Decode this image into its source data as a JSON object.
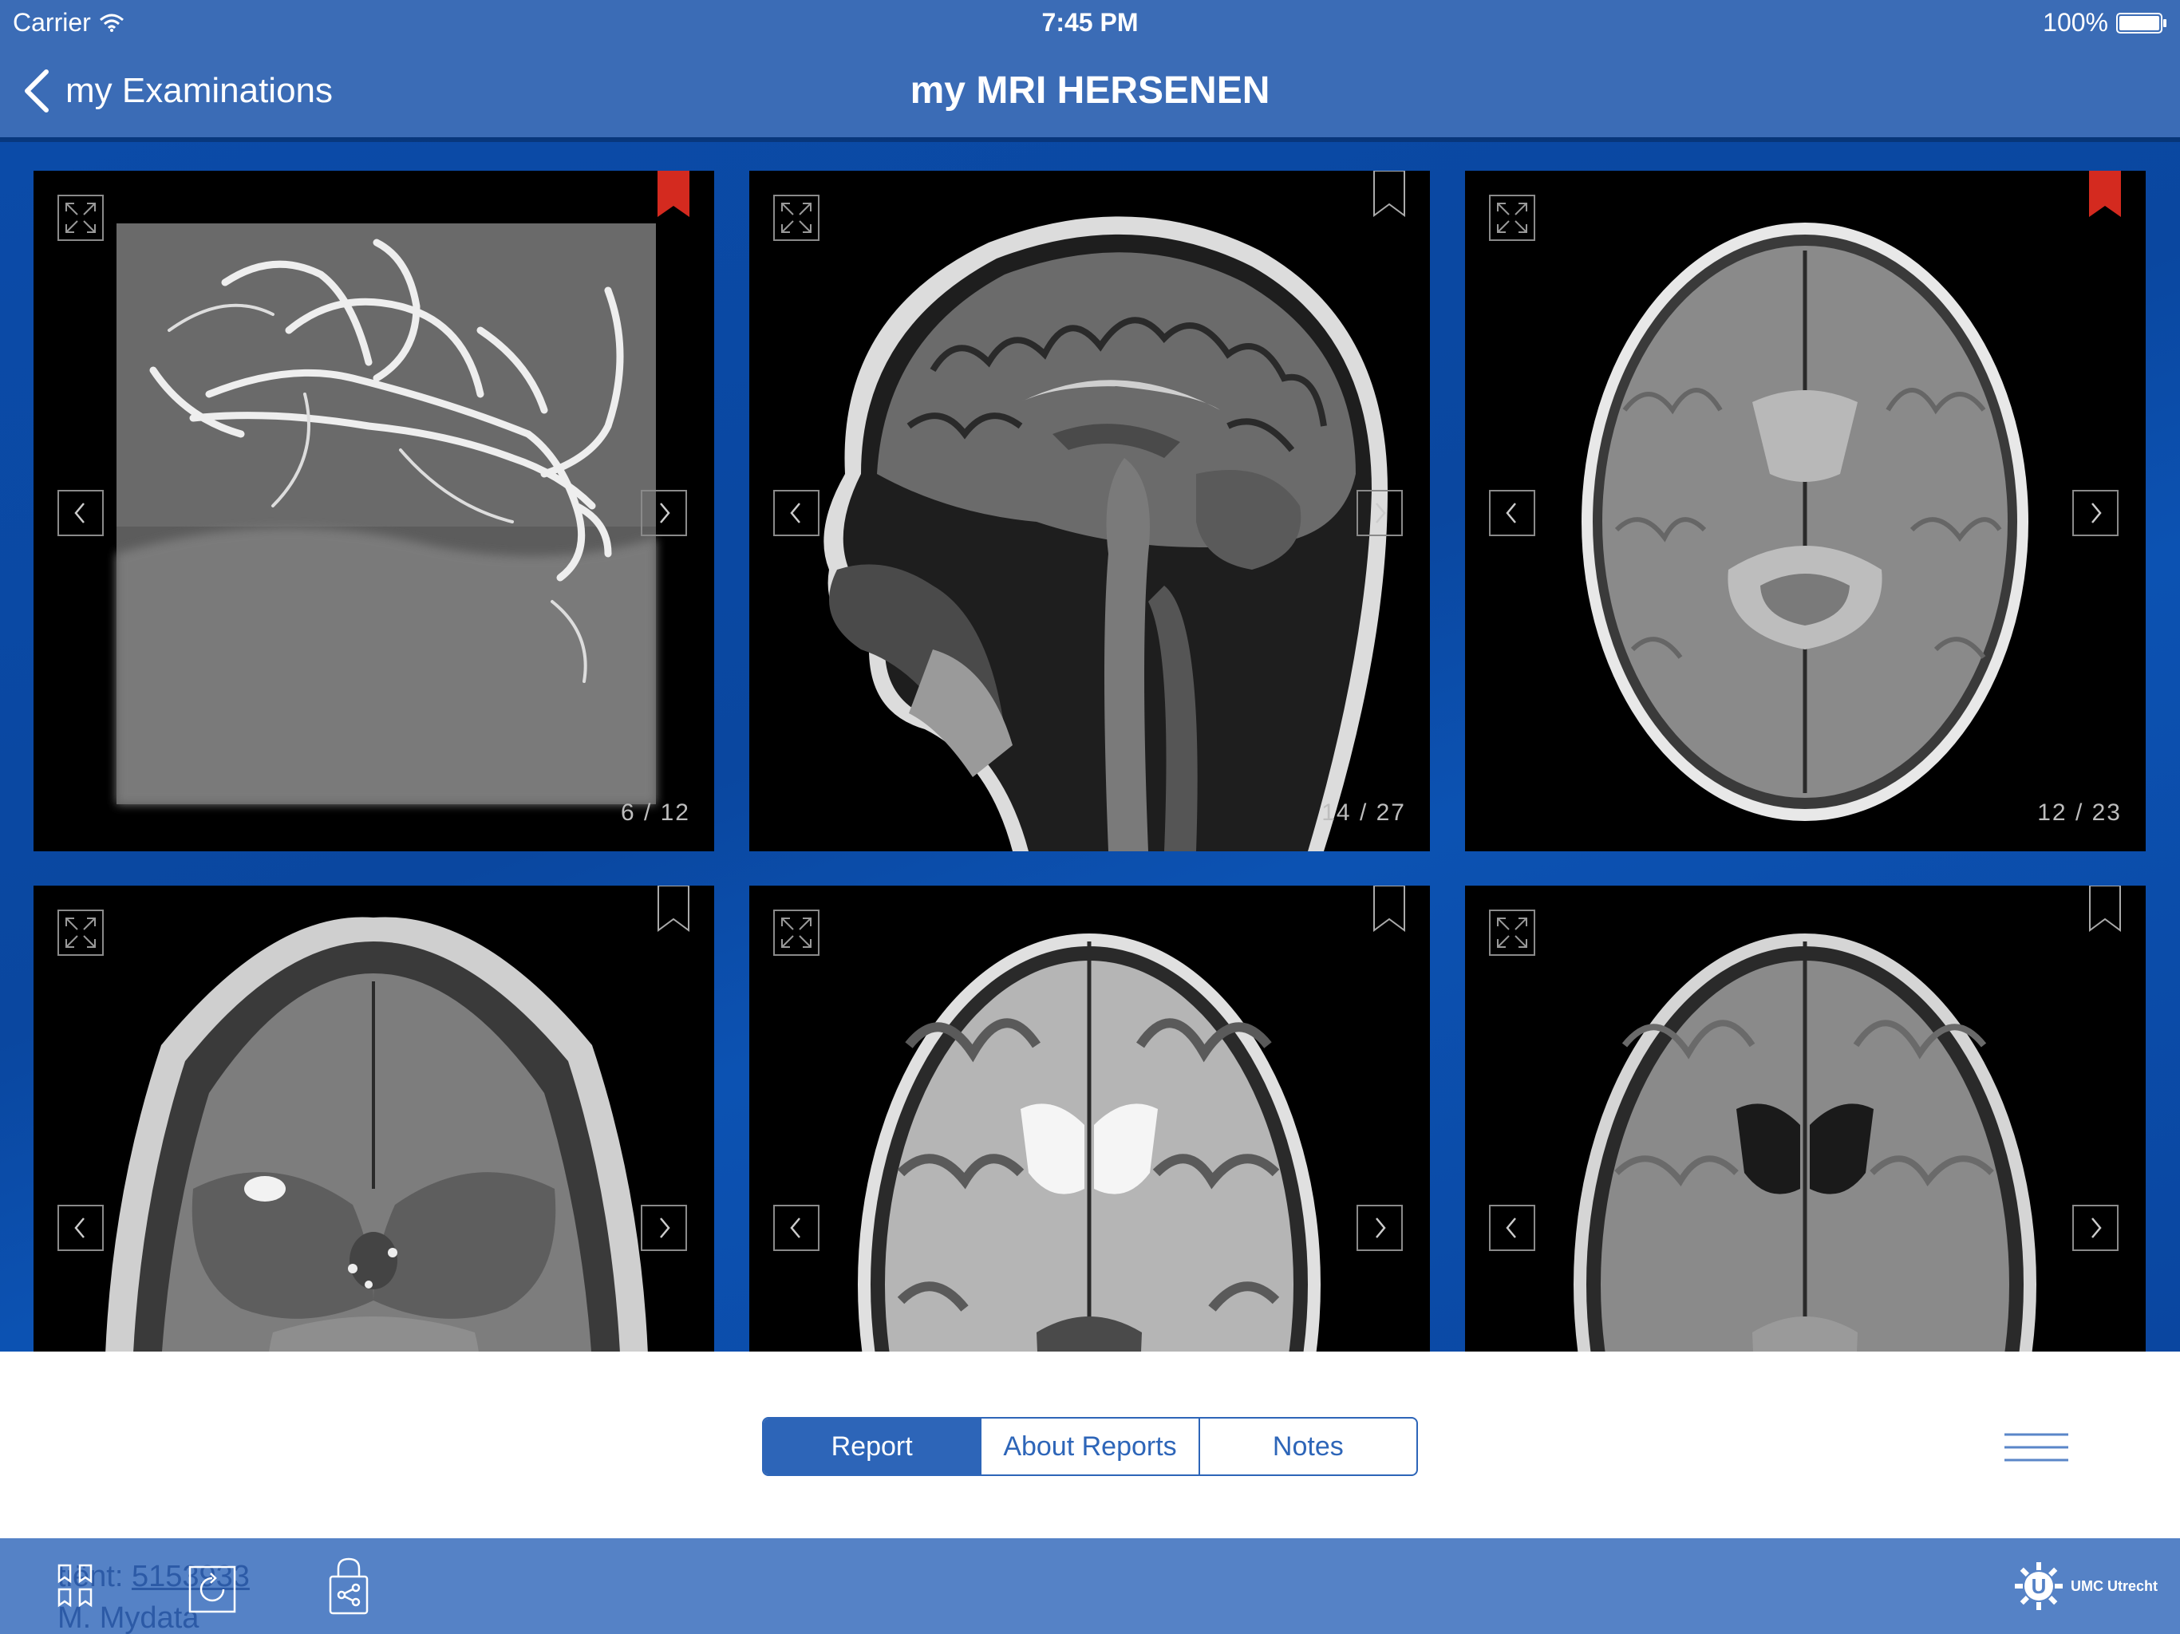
{
  "status_bar": {
    "carrier": "Carrier",
    "time": "7:45 PM",
    "battery": "100%"
  },
  "nav": {
    "back_label": "my Examinations",
    "title": "my MRI HERSENEN"
  },
  "tiles": [
    {
      "counter": "6 / 12",
      "bookmarked": true
    },
    {
      "counter": "14 / 27",
      "bookmarked": false
    },
    {
      "counter": "12 / 23",
      "bookmarked": true
    },
    {
      "counter": "",
      "bookmarked": false
    },
    {
      "counter": "",
      "bookmarked": false
    },
    {
      "counter": "",
      "bookmarked": false
    }
  ],
  "tabs": [
    {
      "label": "Report",
      "active": true
    },
    {
      "label": "About Reports",
      "active": false
    },
    {
      "label": "Notes",
      "active": false
    }
  ],
  "patient": {
    "label_partial": "tiënt:",
    "id_partial": "5153933",
    "name_partial": "M. Mydata"
  },
  "brand": {
    "name": "UMC Utrecht"
  },
  "colors": {
    "bar_blue": "#3b6cb6",
    "grid_blue": "#0d4aa5",
    "toolbar_blue": "#5582c6",
    "accent": "#2d65b8",
    "bookmark_red": "#d42a1f"
  },
  "icons": {
    "back": "chevron-left-icon",
    "expand": "expand-icon",
    "prev": "chevron-left-icon",
    "next": "chevron-right-icon",
    "bookmark": "bookmark-icon",
    "menu": "hamburger-menu-icon",
    "bookmarks_grid": "bookmarks-grid-icon",
    "history": "history-icon",
    "share": "share-lock-icon"
  }
}
